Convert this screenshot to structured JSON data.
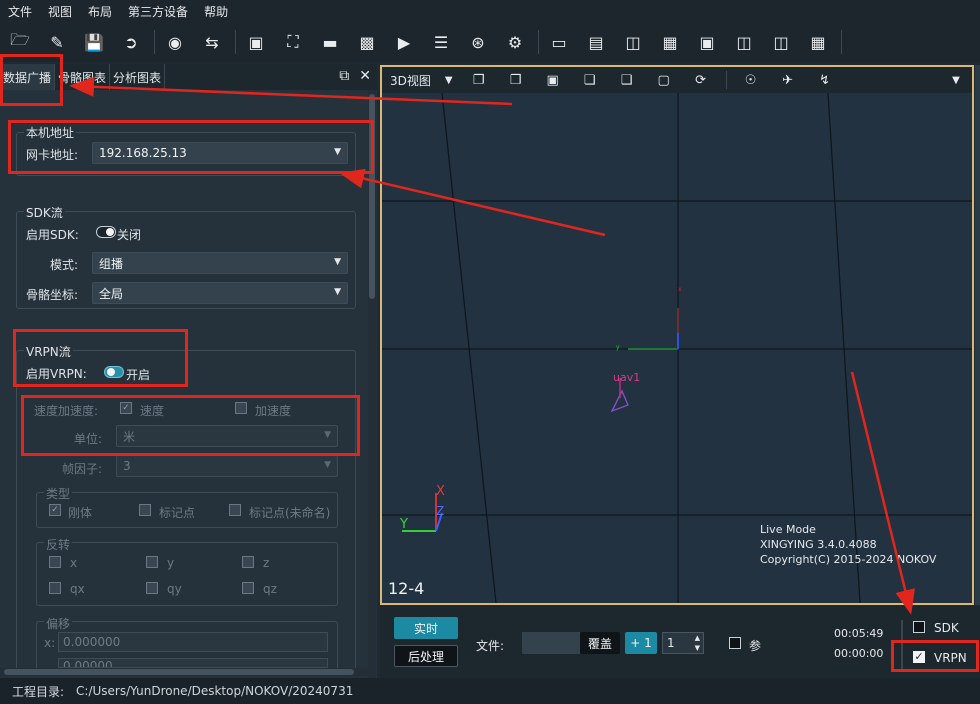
{
  "menu": [
    "文件",
    "视图",
    "布局",
    "第三方设备",
    "帮助"
  ],
  "toolbar_icons": [
    "folder-open-icon",
    "ruler-icon",
    "save-icon",
    "save-as-icon",
    "eye-off-icon",
    "swap-icon",
    "camera-off-icon",
    "expand-icon",
    "ruler-scale-icon",
    "video-icon",
    "play-circle-icon",
    "layers-icon",
    "wifi-broadcast-icon",
    "gear-icon",
    "monitor-icon",
    "layout-top-icon",
    "layout-split-v-icon",
    "layout-split-icon",
    "layout-bottom-icon",
    "layout-right-icon",
    "layout-left-icon",
    "layout-grid-icon",
    "window-icon"
  ],
  "tabs": [
    "数据广播",
    "骨骼图表",
    "分析图表"
  ],
  "local": {
    "group": "本机地址",
    "nic_label": "网卡地址:",
    "nic_value": "192.168.25.13"
  },
  "sdk": {
    "group": "SDK流",
    "enable_label": "启用SDK:",
    "enable_state": "关闭",
    "mode_label": "模式:",
    "mode_value": "组播",
    "coord_label": "骨骼坐标:",
    "coord_value": "全局"
  },
  "vrpn": {
    "group": "VRPN流",
    "enable_label": "启用VRPN:",
    "enable_state": "开启",
    "velacc_label": "速度加速度:",
    "velocity": "速度",
    "acceleration": "加速度",
    "unit_label": "单位:",
    "unit_value": "米",
    "frame_label": "帧因子:",
    "frame_value": "3",
    "type_group": "类型",
    "type_rigid": "刚体",
    "type_marker": "标记点",
    "type_unnamed": "标记点(未命名)",
    "flip_group": "反转",
    "flip_x": "x",
    "flip_y": "y",
    "flip_z": "z",
    "flip_qx": "qx",
    "flip_qy": "qy",
    "flip_qz": "qz",
    "offset_group": "偏移",
    "offset_x_label": "x:",
    "offset_x": "0.000000",
    "offset_y": "0.00000"
  },
  "viewport": {
    "view_name": "3D视图",
    "object_label": "uav1",
    "axis_x": "X",
    "axis_y": "Y",
    "axis_z": "Z",
    "mode": "Live Mode",
    "version": "XINGYING 3.4.0.4088",
    "copyright": "Copyright(C) 2015-2024 NOKOV",
    "frame": "12-4"
  },
  "playback": {
    "realtime": "实时",
    "post": "后处理",
    "file_label": "文件:",
    "overwrite": "覆盖",
    "plus_one": "+ 1",
    "spin_value": "1",
    "param_label": "参",
    "time1": "00:05:49",
    "time2": "00:00:00",
    "sdk": "SDK",
    "vrpn": "VRPN"
  },
  "status": {
    "label": "工程目录:",
    "path": "C:/Users/YunDrone/Desktop/NOKOV/20240731"
  },
  "colors": {
    "accent": "#2b8fa8",
    "highlight": "#e0261d",
    "viewport_border": "#d9b87a"
  }
}
